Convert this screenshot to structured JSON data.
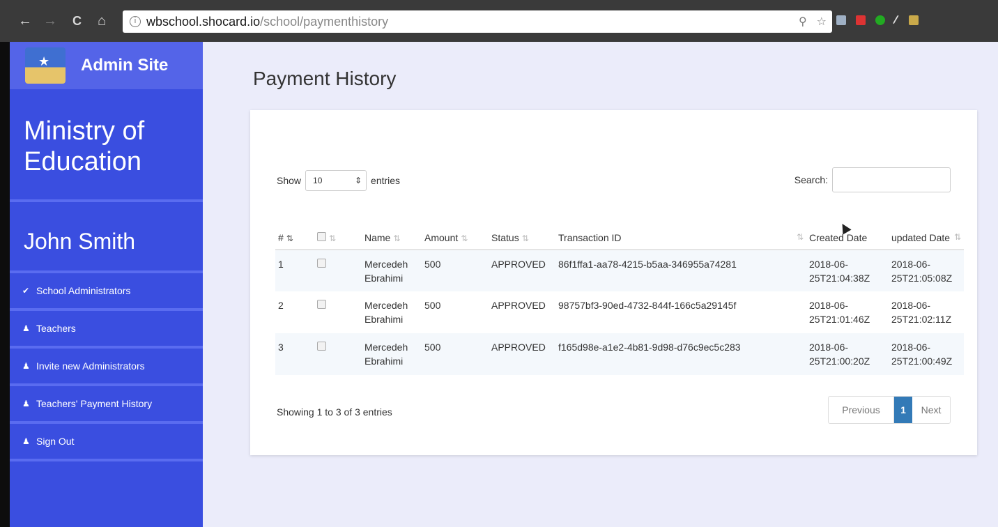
{
  "browser": {
    "url_host": "wbschool.shocard.io",
    "url_path": "/school/paymenthistory",
    "back_icon": "←",
    "forward_icon": "→",
    "reload_icon": "C",
    "home_icon": "⌂",
    "info_icon": "i",
    "zoom_icon": "⚲",
    "bookmark_icon": "☆"
  },
  "sidebar": {
    "site_name": "Admin Site",
    "ministry_line1": "Ministry of",
    "ministry_line2": "Education",
    "user_name": "John Smith",
    "items": [
      {
        "label": "School Administrators",
        "icon": "✔"
      },
      {
        "label": "Teachers",
        "icon": "♟"
      },
      {
        "label": "Invite new Administrators",
        "icon": "♟"
      },
      {
        "label": "Teachers' Payment History",
        "icon": "♟"
      },
      {
        "label": "Sign Out",
        "icon": "♟"
      }
    ]
  },
  "main": {
    "title": "Payment History",
    "show_label": "Show",
    "entries_value": "10",
    "entries_label": "entries",
    "search_label": "Search:",
    "columns": [
      "#",
      "",
      "Name",
      "Amount",
      "Status",
      "Transaction ID",
      "Created Date",
      "updated Date"
    ],
    "rows": [
      {
        "num": "1",
        "name_first": "Mercedeh",
        "name_last": "Ebrahimi",
        "amount": "500",
        "status": "APPROVED",
        "transaction_id": "86f1ffa1-aa78-4215-b5aa-346955a74281",
        "created_1": "2018-06-",
        "created_2": "25T21:04:38Z",
        "updated_1": "2018-06-",
        "updated_2": "25T21:05:08Z"
      },
      {
        "num": "2",
        "name_first": "Mercedeh",
        "name_last": "Ebrahimi",
        "amount": "500",
        "status": "APPROVED",
        "transaction_id": "98757bf3-90ed-4732-844f-166c5a29145f",
        "created_1": "2018-06-",
        "created_2": "25T21:01:46Z",
        "updated_1": "2018-06-",
        "updated_2": "25T21:02:11Z"
      },
      {
        "num": "3",
        "name_first": "Mercedeh",
        "name_last": "Ebrahimi",
        "amount": "500",
        "status": "APPROVED",
        "transaction_id": "f165d98e-a1e2-4b81-9d98-d76c9ec5c283",
        "created_1": "2018-06-",
        "created_2": "25T21:00:20Z",
        "updated_1": "2018-06-",
        "updated_2": "25T21:00:49Z"
      }
    ],
    "showing_info": "Showing 1 to 3 of 3 entries",
    "pager": {
      "previous": "Previous",
      "current": "1",
      "next": "Next"
    }
  },
  "colors": {
    "sidebar_bg": "#3a4ee0",
    "sidebar_header_bg": "#5464e8",
    "main_bg": "#ebecfa",
    "pager_active": "#337ab7"
  }
}
